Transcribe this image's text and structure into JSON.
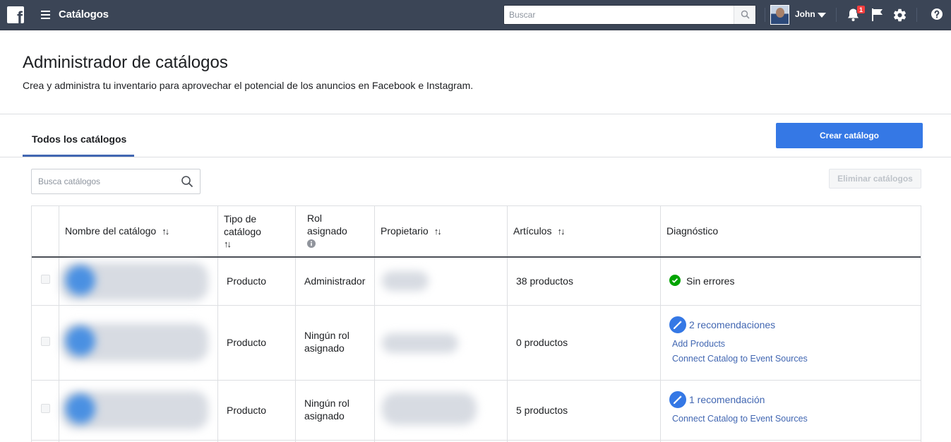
{
  "topbar": {
    "logo_letter": "f",
    "app_title": "Catálogos",
    "search_placeholder": "Buscar",
    "user_name": "John",
    "notification_count": "1"
  },
  "header": {
    "title": "Administrador de catálogos",
    "subtitle": "Crea y administra tu inventario para aprovechar el potencial de los anuncios en Facebook e Instagram."
  },
  "tabs": {
    "active": "Todos los catálogos"
  },
  "actions": {
    "create_label": "Crear catálogo",
    "delete_label": "Eliminar catálogos",
    "search_placeholder": "Busca catálogos"
  },
  "table": {
    "columns": {
      "name": "Nombre del catálogo",
      "type_l1": "Tipo de",
      "type_l2": "catálogo",
      "role_l1": "Rol",
      "role_l2": "asignado",
      "owner": "Propietario",
      "items": "Artículos",
      "diagnostics": "Diagnóstico",
      "sort_glyph": "↑↓"
    },
    "rows": [
      {
        "type": "Producto",
        "role": "Administrador",
        "items": "38 productos",
        "diagnostic": "Sin errores"
      },
      {
        "type": "Producto",
        "role_l1": "Ningún rol",
        "role_l2": "asignado",
        "items": "0 productos",
        "diagnostic": "2 recomendaciones",
        "link1": "Add Products",
        "link2": "Connect Catalog to Event Sources"
      },
      {
        "type": "Producto",
        "role_l1": "Ningún rol",
        "role_l2": "asignado",
        "items": "5 productos",
        "diagnostic": "1 recomendación",
        "link1": "Connect Catalog to Event Sources"
      }
    ]
  },
  "colors": {
    "topbar": "#3b4556",
    "primary": "#3578e5",
    "link": "#4267b2",
    "success": "#00a400",
    "badge": "#fa3e3e"
  }
}
